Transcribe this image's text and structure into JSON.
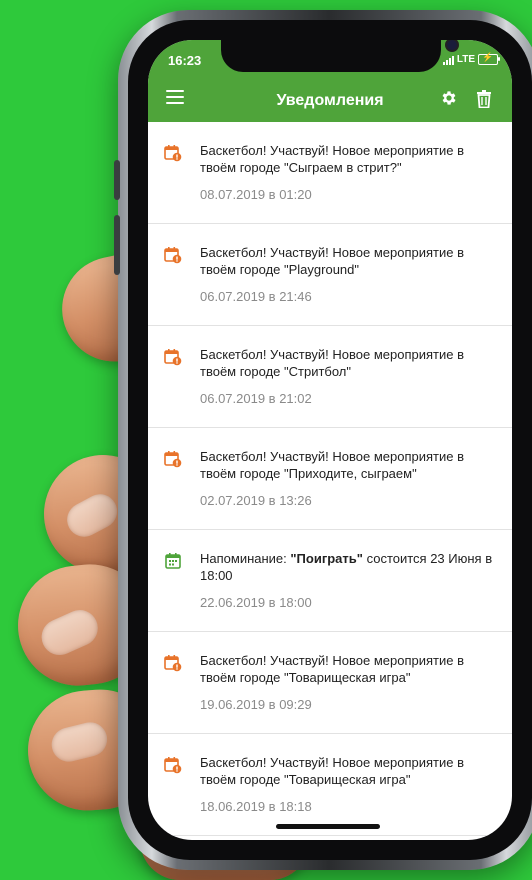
{
  "status_bar": {
    "time": "16:23",
    "network": "LTE"
  },
  "app_bar": {
    "title": "Уведомления"
  },
  "icons": {
    "menu": "hamburger-menu-icon",
    "settings": "gear-icon",
    "delete": "trash-icon",
    "event": "calendar-alert-icon",
    "reminder": "calendar-icon"
  },
  "colors": {
    "background": "#2ec93b",
    "app_bar": "#4fa43a",
    "event_icon": "#e8732a",
    "reminder_icon": "#4fa43a"
  },
  "notifications": [
    {
      "type": "event",
      "text": "Баскетбол! Участвуй! Новое мероприятие в твоём городе \"Сыграем в стрит?\"",
      "date": "08.07.2019 в 01:20"
    },
    {
      "type": "event",
      "text": "Баскетбол! Участвуй! Новое мероприятие в твоём городе \"Playground\"",
      "date": "06.07.2019 в 21:46"
    },
    {
      "type": "event",
      "text": "Баскетбол! Участвуй! Новое мероприятие в твоём городе \"Стритбол\"",
      "date": "06.07.2019 в 21:02"
    },
    {
      "type": "event",
      "text": "Баскетбол! Участвуй! Новое мероприятие в твоём городе \"Приходите, сыграем\"",
      "date": "02.07.2019 в 13:26"
    },
    {
      "type": "reminder",
      "text_prefix": "Напоминание: ",
      "text_bold": "\"Поиграть\"",
      "text_suffix": " состоится 23 Июня в 18:00",
      "date": "22.06.2019 в 18:00"
    },
    {
      "type": "event",
      "text": "Баскетбол! Участвуй! Новое мероприятие в твоём городе \"Товарищеская игра\"",
      "date": "19.06.2019 в 09:29"
    },
    {
      "type": "event",
      "text": "Баскетбол! Участвуй! Новое мероприятие в твоём городе \"Товарищеская игра\"",
      "date": "18.06.2019 в 18:18"
    }
  ]
}
